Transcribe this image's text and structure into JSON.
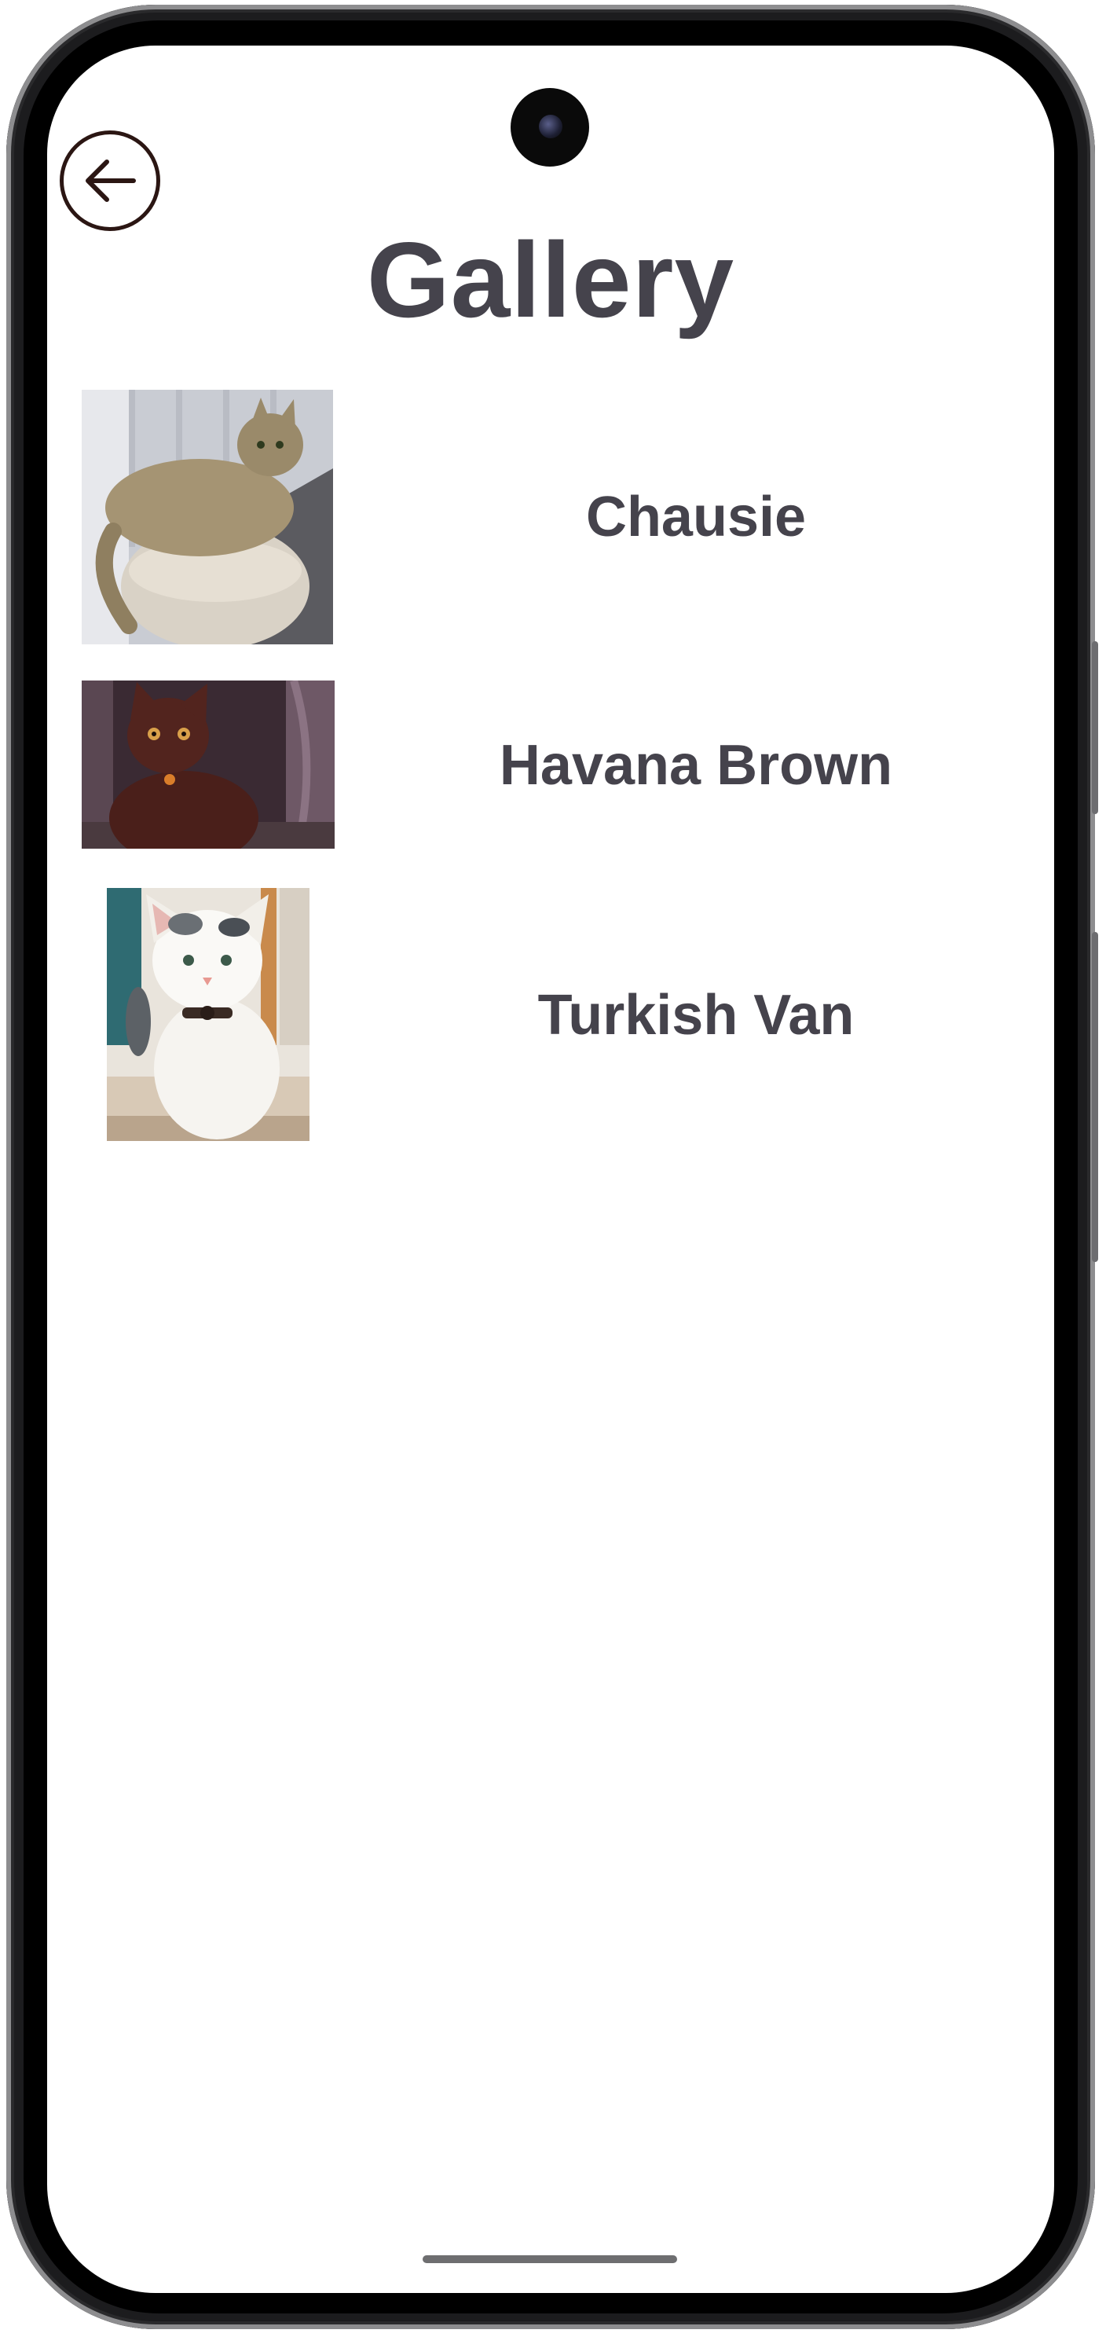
{
  "header": {
    "title": "Gallery",
    "back_icon": "arrow-left-icon"
  },
  "gallery": {
    "items": [
      {
        "label": "Chausie",
        "image": "cat-photo-tabby-on-cushion"
      },
      {
        "label": "Havana Brown",
        "image": "cat-photo-brown-cat"
      },
      {
        "label": "Turkish Van",
        "image": "cat-photo-white-cat-with-bowtie"
      }
    ]
  },
  "colors": {
    "text": "#45434c",
    "back_button_border": "#2b1613",
    "background": "#ffffff"
  }
}
